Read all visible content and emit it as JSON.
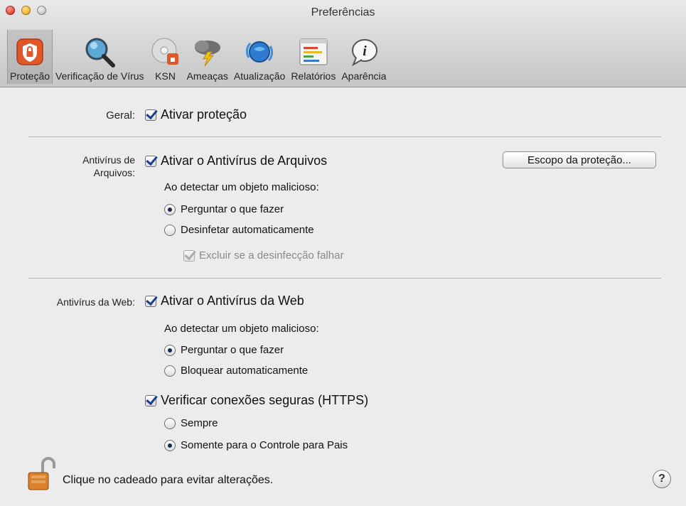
{
  "window": {
    "title": "Preferências"
  },
  "toolbar": {
    "items": [
      {
        "label": "Proteção",
        "icon": "shield-lock-icon",
        "selected": true
      },
      {
        "label": "Verificação de Vírus",
        "icon": "magnifier-icon"
      },
      {
        "label": "KSN",
        "icon": "ksn-disc-icon"
      },
      {
        "label": "Ameaças",
        "icon": "storm-cloud-icon"
      },
      {
        "label": "Atualização",
        "icon": "update-globe-icon"
      },
      {
        "label": "Relatórios",
        "icon": "report-chart-icon"
      },
      {
        "label": "Aparência",
        "icon": "info-bubble-icon"
      }
    ]
  },
  "general": {
    "label": "Geral:",
    "enable_protection": {
      "label": "Ativar proteção",
      "checked": true
    }
  },
  "file_av": {
    "label_line1": "Antivírus de",
    "label_line2": "Arquivos:",
    "enable": {
      "label": "Ativar o Antivírus de Arquivos",
      "checked": true
    },
    "scope_button": "Escopo da proteção...",
    "on_detect": "Ao detectar um objeto malicioso:",
    "options": [
      {
        "label": "Perguntar o que fazer",
        "selected": true
      },
      {
        "label": "Desinfetar automaticamente",
        "selected": false
      }
    ],
    "delete_if_fail": {
      "label": "Excluir se a desinfecção falhar",
      "checked": true,
      "disabled": true
    }
  },
  "web_av": {
    "label": "Antivírus da Web:",
    "enable": {
      "label": "Ativar o Antivírus da Web",
      "checked": true
    },
    "on_detect": "Ao detectar um objeto malicioso:",
    "options": [
      {
        "label": "Perguntar o que fazer",
        "selected": true
      },
      {
        "label": "Bloquear automaticamente",
        "selected": false
      }
    ],
    "https": {
      "label": "Verificar conexões seguras (HTTPS)",
      "checked": true
    },
    "https_options": [
      {
        "label": "Sempre",
        "selected": false
      },
      {
        "label": "Somente para o Controle para Pais",
        "selected": true
      }
    ]
  },
  "footer": {
    "lock_text": "Clique no cadeado para evitar alterações.",
    "help": "?"
  },
  "colors": {
    "shield_orange": "#e0572a",
    "checkmark_blue": "#1a3f8f",
    "separator": "#b8b8b8"
  }
}
